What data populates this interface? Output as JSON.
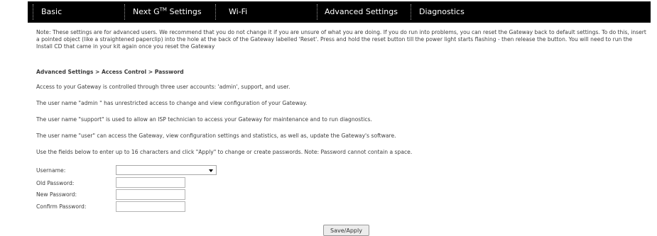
{
  "nav": {
    "tabs": [
      {
        "label": "Basic"
      },
      {
        "label_pre": "Next G",
        "label_sup": "TM",
        "label_post": " Settings"
      },
      {
        "label": "Wi-Fi"
      },
      {
        "label": "Advanced Settings"
      },
      {
        "label": "Diagnostics"
      }
    ]
  },
  "note": "Note: These settings are for advanced users. We recommend that you do not change it if you are unsure of what you are doing. If you do run into problems, you can reset the Gateway back to default settings. To do this, insert a pointed object (like a straightened paperclip) into the hole at the back of the Gateway labelled 'Reset'. Press and hold the reset button till the power light starts flashing - then release the button. You will need to run the Install CD that came in your kit again once you reset the Gateway",
  "breadcrumb": "Advanced Settings > Access Control > Password",
  "paragraphs": [
    "Access to your Gateway is controlled through three user accounts: 'admin', support, and user.",
    "The user name \"admin \" has unrestricted access to change and view configuration of your Gateway.",
    "The user name \"support\" is used to allow an ISP technician to access your Gateway for maintenance and to run diagnostics.",
    "The user name \"user\" can access the Gateway, view configuration settings and statistics, as well as, update the Gateway's software.",
    "Use the fields below to enter up to 16 characters and click \"Apply\" to change or create passwords. Note: Password cannot contain a space."
  ],
  "form": {
    "username_label": "Username:",
    "username_value": "",
    "old_password_label": "Old Password:",
    "new_password_label": "New Password:",
    "confirm_password_label": "Confirm Password:"
  },
  "save_apply_label": "Save/Apply"
}
